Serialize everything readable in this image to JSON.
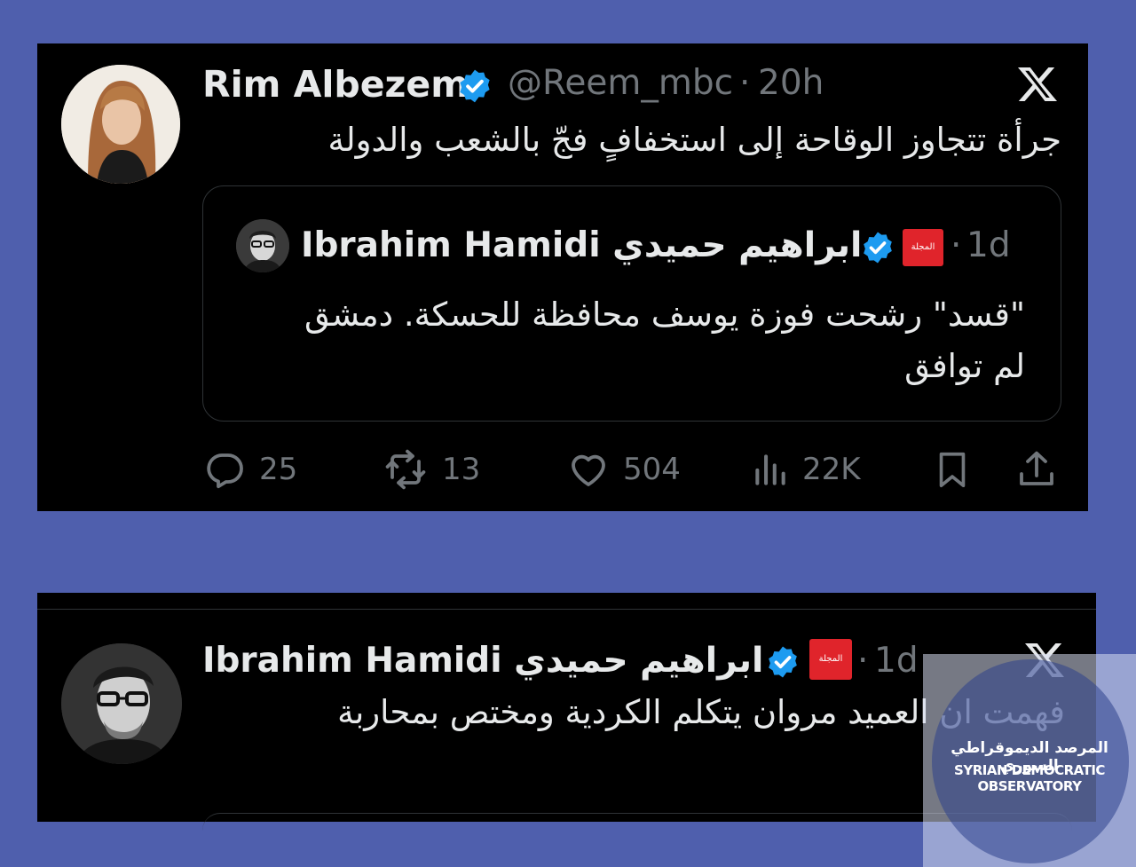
{
  "tweet1": {
    "author_name": "Rim Albezem",
    "handle": "@Reem_mbc",
    "dot": "·",
    "time": "20h",
    "text": "جرأة تتجاوز الوقاحة إلى استخفافٍ فجّ بالشعب والدولة",
    "quote": {
      "author_name": "Ibrahim Hamidi ابراهيم حميدي",
      "badge": "المجلة",
      "dot": "·",
      "time": "1d",
      "text_line1": "\"قسد\" رشحت فوزة يوسف محافظة للحسكة. دمشق",
      "text_line2": "لم توافق"
    },
    "actions": {
      "replies": "25",
      "reposts": "13",
      "likes": "504",
      "views": "22K"
    }
  },
  "tweet2": {
    "author_name": "Ibrahim Hamidi ابراهيم حميدي",
    "badge": "المجلة",
    "dot": "·",
    "time": "1d",
    "text": "فهمت ان العميد مروان يتكلم الكردية ومختص بمحاربة"
  },
  "watermark": {
    "arabic": "المرصد الديموقراطي السوري",
    "english": "SYRIAN DEMOCRATIC OBSERVATORY"
  },
  "colors": {
    "page_background": "#4f5fad",
    "panel_background": "#000000",
    "verified_blue": "#1d9bf0",
    "muted_text": "#71767b",
    "badge_red": "#e0242b"
  },
  "icons": [
    "x-logo-icon",
    "verified-icon",
    "reply-icon",
    "repost-icon",
    "like-icon",
    "views-icon",
    "bookmark-icon",
    "share-icon"
  ]
}
